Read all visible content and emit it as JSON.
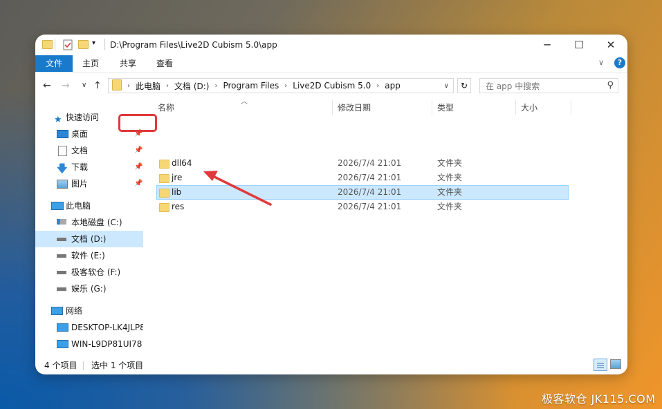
{
  "title": "D:\\Program Files\\Live2D Cubism 5.0\\app",
  "window_controls": {
    "minimize": "─",
    "maximize": "☐",
    "close": "✕"
  },
  "ribbon": {
    "tabs": [
      "文件",
      "主页",
      "共享",
      "查看"
    ],
    "expand": "∨",
    "help": "?"
  },
  "address": {
    "segments": [
      "此电脑",
      "文档 (D:)",
      "Program Files",
      "Live2D Cubism 5.0",
      "app"
    ],
    "separator": "›",
    "dropdown": "∨",
    "refresh": "↻"
  },
  "search": {
    "placeholder": "在 app 中搜索",
    "icon": "⚲"
  },
  "nav_buttons": {
    "back": "←",
    "forward": "→",
    "recent": "∨",
    "up": "↑"
  },
  "sidebar": {
    "quick_access": "快速访问",
    "quick_items": [
      "桌面",
      "文档",
      "下载",
      "图片"
    ],
    "this_pc": "此电脑",
    "drives": [
      "本地磁盘 (C:)",
      "文档 (D:)",
      "软件 (E:)",
      "极客软仓 (F:)",
      "娱乐 (G:)"
    ],
    "network": "网络",
    "network_items": [
      "DESKTOP-LK4JLP8",
      "WIN-L9DP81UI78"
    ],
    "selected": "文档 (D:)"
  },
  "columns": {
    "name": "名称",
    "modified": "修改日期",
    "type": "类型",
    "size": "大小"
  },
  "files": [
    {
      "name": "dll64",
      "modified": "2026/7/4 21:01",
      "type": "文件夹"
    },
    {
      "name": "jre",
      "modified": "2026/7/4 21:01",
      "type": "文件夹"
    },
    {
      "name": "lib",
      "modified": "2026/7/4 21:01",
      "type": "文件夹"
    },
    {
      "name": "res",
      "modified": "2026/7/4 21:01",
      "type": "文件夹"
    }
  ],
  "selected_file": "lib",
  "status": {
    "count": "4 个项目",
    "selection": "选中 1 个项目"
  },
  "watermark": "极客软仓 JK115.COM",
  "colors": {
    "accent": "#1979ca",
    "selection": "#cce8ff",
    "annotation": "#e0393b",
    "folder": "#f7d774"
  }
}
